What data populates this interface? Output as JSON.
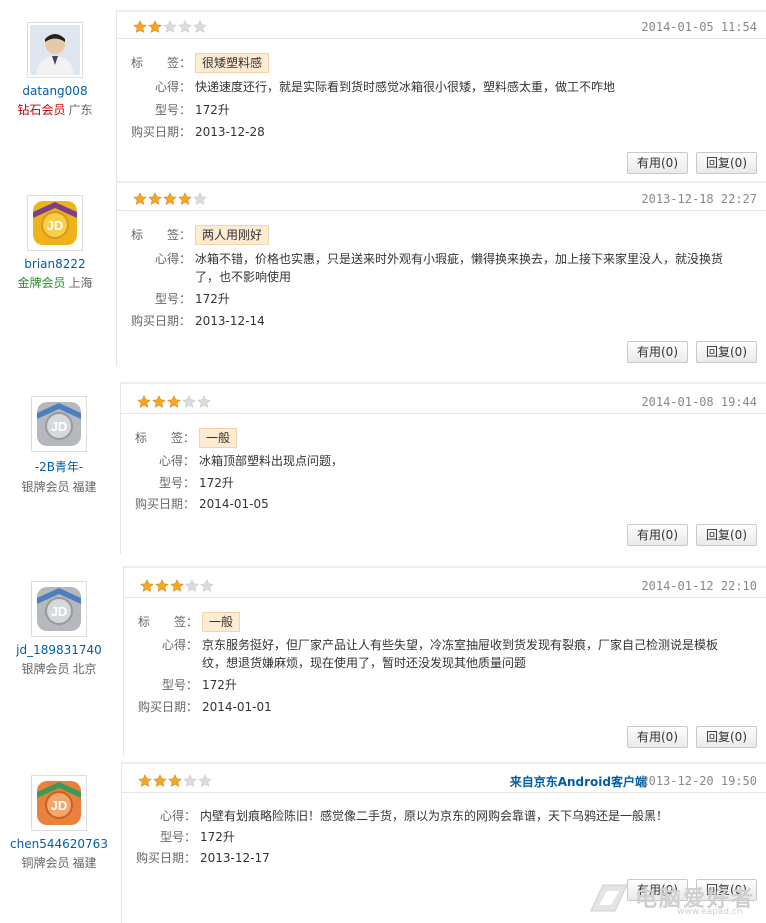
{
  "labels": {
    "tag": "标　　签：",
    "experience": "心得：",
    "model": "型号：",
    "purchase_date": "购买日期："
  },
  "reviews": [
    {
      "user": "datang008",
      "level": "钻石会员",
      "location": "广东",
      "rating": 2,
      "date": "2014-01-05 11:54",
      "source": "",
      "tag": "很矮塑料感",
      "experience": "快递速度还行，就是实际看到货时感觉冰箱很小很矮，塑料感太重，做工不咋地",
      "model": "172升",
      "purchase_date": "2013-12-28",
      "useful": "有用(0)",
      "reply": "回复(0)",
      "avatar": "person-photo"
    },
    {
      "user": "brian8222",
      "level": "金牌会员",
      "location": "上海",
      "rating": 4,
      "date": "2013-12-18 22:27",
      "source": "",
      "tag": "两人用刚好",
      "experience": "冰箱不错，价格也实惠，只是送来时外观有小瑕疵，懒得换来换去，加上接下来家里没人，就没换货了，也不影响使用",
      "model": "172升",
      "purchase_date": "2013-12-14",
      "useful": "有用(0)",
      "reply": "回复(0)",
      "avatar": "gold-jd-badge"
    },
    {
      "user": "-2B青年-",
      "level": "银牌会员",
      "location": "福建",
      "rating": 3,
      "date": "2014-01-08 19:44",
      "source": "",
      "tag": "一般",
      "experience": "冰箱顶部塑料出现点问题，",
      "model": "172升",
      "purchase_date": "2014-01-05",
      "useful": "有用(0)",
      "reply": "回复(0)",
      "avatar": "silver-jd-badge"
    },
    {
      "user": "jd_189831740",
      "level": "银牌会员",
      "location": "北京",
      "rating": 3,
      "date": "2014-01-12 22:10",
      "source": "",
      "tag": "一般",
      "experience": "京东服务挺好，但厂家产品让人有些失望，冷冻室抽屉收到货发现有裂痕，厂家自己检测说是模板纹，想退货嫌麻烦，现在使用了，暂时还没发现其他质量问题",
      "model": "172升",
      "purchase_date": "2014-01-01",
      "useful": "有用(0)",
      "reply": "回复(0)",
      "avatar": "silver-jd-badge"
    },
    {
      "user": "chen544620763",
      "level": "铜牌会员",
      "location": "福建",
      "rating": 3,
      "date": "2013-12-20 19:50",
      "source": "来自京东Android客户端",
      "tag": "",
      "experience": "内壁有划痕略险陈旧！感觉像二手货，原以为京东的网购会靠谱，天下乌鸦还是一般黑！",
      "model": "172升",
      "purchase_date": "2013-12-17",
      "useful": "有用(0)",
      "reply": "回复(0)",
      "avatar": "bronze-jd-badge"
    }
  ],
  "watermark": {
    "text": "电脑爱好者",
    "url": "www.eapad.cn"
  },
  "colors": {
    "star": "#f5a623",
    "star_empty": "#dcdcdc",
    "user_link": "#005ea7",
    "diamond": "#cc0000",
    "gold": "#2a8f2a"
  }
}
